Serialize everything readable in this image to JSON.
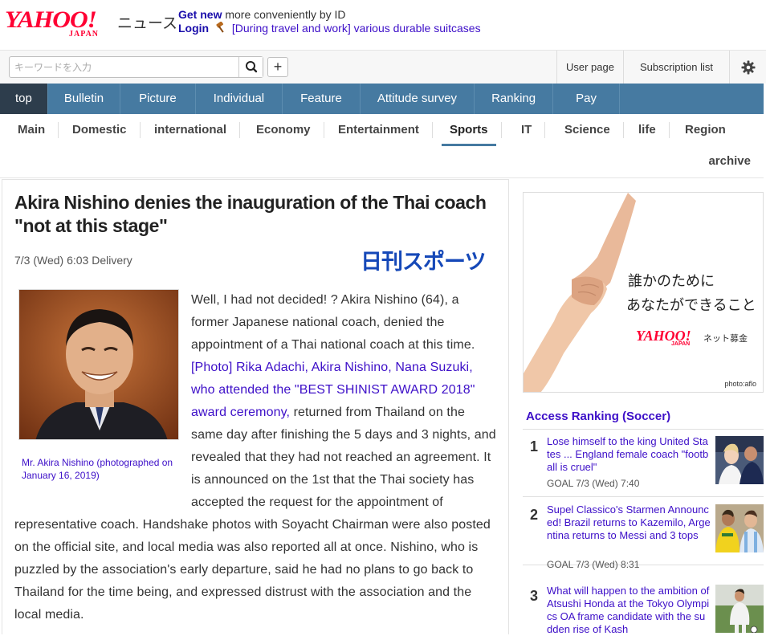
{
  "header": {
    "logo_text": "YAHOO!",
    "logo_sub": "JAPAN",
    "service_name": "ニュース",
    "promo_get_new": "Get new",
    "promo_get_new_rest": "more conveniently by ID",
    "promo_login": "Login",
    "promo_link": "[During travel and work] various durable suitcases"
  },
  "search": {
    "placeholder": "キーワードを入力",
    "plus_label": "+"
  },
  "util": {
    "user_page": "User page",
    "subscription_list": "Subscription list"
  },
  "main_nav": [
    {
      "label": "top",
      "active": true
    },
    {
      "label": "Bulletin"
    },
    {
      "label": "Picture"
    },
    {
      "label": "Individual"
    },
    {
      "label": "Feature"
    },
    {
      "label": "Attitude survey"
    },
    {
      "label": "Ranking"
    },
    {
      "label": "Pay"
    }
  ],
  "sub_nav": [
    {
      "label": "Main"
    },
    {
      "label": "Domestic"
    },
    {
      "label": "international"
    },
    {
      "label": "Economy"
    },
    {
      "label": "Entertainment"
    },
    {
      "label": "Sports",
      "active": true
    },
    {
      "label": "IT"
    },
    {
      "label": "Science"
    },
    {
      "label": "life"
    },
    {
      "label": "Region"
    }
  ],
  "archive_label": "archive",
  "article": {
    "title": "Akira Nishino denies the inauguration of the Thai coach \"not at this stage\"",
    "date": "7/3 (Wed) 6:03 Delivery",
    "source_logo": "日刊スポーツ",
    "photo_caption": "Mr. Akira Nishino (photographed on January 16, 2019)",
    "body_intro": "Well, I had not decided! ? Akira Nishino (64), a former Japanese national coach, denied the appointment of a Thai national coach at this time. ",
    "body_link": "[Photo] Rika Adachi, Akira Nishino, Nana Suzuki, who attended the \"BEST SHINIST AWARD 2018\" award ceremony,",
    "body_rest": " returned from Thailand on the same day after finishing the 5 days and 3 nights, and revealed that they had not reached an agreement. It is announced on the 1st that the Thai society has accepted the request for the appointment of representative coach. Handshake photos with Soyacht Chairman were also posted on the official site, and local media was also reported all at once. Nishino, who is puzzled by the association's early departure, said he had no plans to go back to Thailand for the time being, and expressed distrust with the association and the local media."
  },
  "ad": {
    "line1": "誰かのために",
    "line2": "あなたができること",
    "brand": "YAHOO!",
    "brand_sub": "JAPAN",
    "brand_service": "ネット募金",
    "credit": "photo:aflo"
  },
  "ranking": {
    "title": "Access Ranking (Soccer)",
    "items": [
      {
        "rank": "1",
        "title": "Lose himself to the king United States ... England female coach \"football is cruel\"",
        "meta": "GOAL 7/3 (Wed) 7:40"
      },
      {
        "rank": "2",
        "title": "Supel Classico's Starmen Announced! Brazil returns to Kazemilo, Argentina returns to Messi and 3 tops",
        "meta": "GOAL 7/3 (Wed) 8:31"
      },
      {
        "rank": "3",
        "title": "What will happen to the ambition of Atsushi Honda at the Tokyo Olympics OA frame candidate with the sudden rise of Kash",
        "meta": ""
      }
    ]
  },
  "colors": {
    "brand_red": "#ff0033",
    "nav_blue": "#467aa1",
    "nav_active": "#2d3d4c",
    "link_purple": "#3d0fc8"
  }
}
